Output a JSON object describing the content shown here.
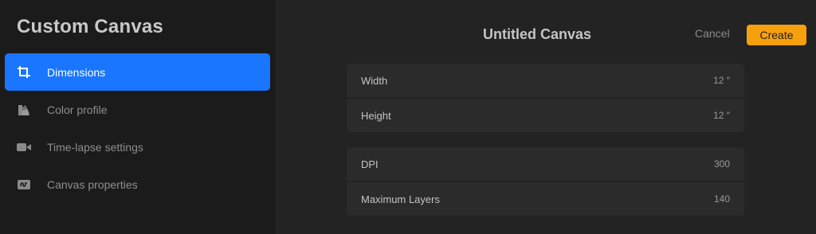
{
  "sidebar": {
    "title": "Custom Canvas",
    "items": [
      {
        "label": "Dimensions",
        "icon": "crop-icon",
        "active": true
      },
      {
        "label": "Color profile",
        "icon": "color-swatch-icon",
        "active": false
      },
      {
        "label": "Time-lapse settings",
        "icon": "video-camera-icon",
        "active": false
      },
      {
        "label": "Canvas properties",
        "icon": "canvas-properties-icon",
        "active": false
      }
    ]
  },
  "header": {
    "title": "Untitled Canvas",
    "cancel_label": "Cancel",
    "create_label": "Create"
  },
  "dimensions": {
    "width": {
      "label": "Width",
      "value": "12 ″"
    },
    "height": {
      "label": "Height",
      "value": "12 ″"
    },
    "dpi": {
      "label": "DPI",
      "value": "300"
    },
    "max_layers": {
      "label": "Maximum Layers",
      "value": "140"
    }
  },
  "colors": {
    "accent": "#1a75ff",
    "create_button": "#f5a00c"
  }
}
